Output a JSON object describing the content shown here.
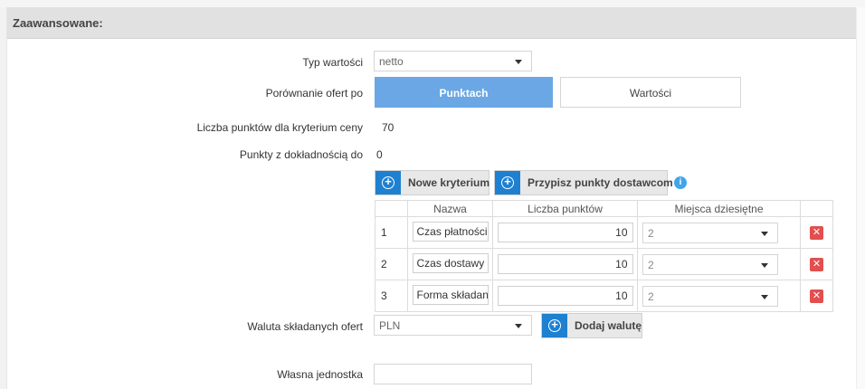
{
  "section": {
    "title": "Zaawansowane:"
  },
  "fields": {
    "value_type": {
      "label": "Typ wartości",
      "value": "netto"
    },
    "comparison": {
      "label": "Porównanie ofert po",
      "option_points": "Punktach",
      "option_values": "Wartości",
      "selected": "Punktach"
    },
    "price_points": {
      "label": "Liczba punktów dla kryterium ceny",
      "value": "70"
    },
    "precision": {
      "label": "Punkty z dokładnością do",
      "value": "0"
    },
    "currency": {
      "label": "Waluta składanych ofert",
      "value": "PLN",
      "add_label": "Dodaj walutę"
    },
    "own_unit": {
      "label": "Własna jednostka",
      "value": ""
    }
  },
  "toolbar": {
    "new_criterion": "Nowe kryterium",
    "assign_points": "Przypisz punkty dostawcom",
    "info_icon": "i"
  },
  "table": {
    "headers": [
      "",
      "Nazwa",
      "Liczba punktów",
      "Miejsca dziesiętne",
      ""
    ],
    "rows": [
      {
        "index": "1",
        "name": "Czas płatności",
        "points": "10",
        "decimals": "2"
      },
      {
        "index": "2",
        "name": "Czas dostawy",
        "points": "10",
        "decimals": "2"
      },
      {
        "index": "3",
        "name": "Forma składani",
        "points": "10",
        "decimals": "2"
      }
    ],
    "delete_symbol": "✕"
  },
  "colors": {
    "accent": "#1e80d0",
    "active_segment": "#6aa7e4",
    "delete": "#e34f4f",
    "info": "#42a5e8"
  }
}
